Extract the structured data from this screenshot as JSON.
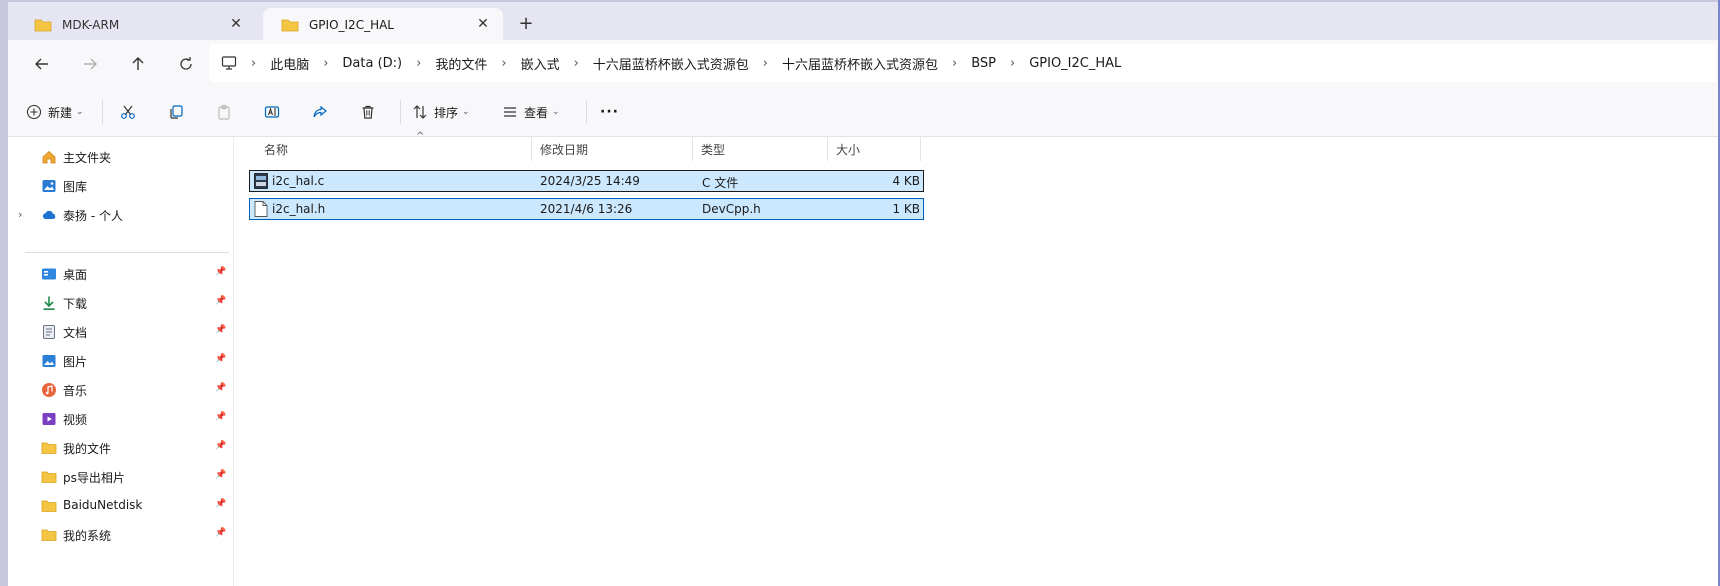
{
  "tabs": [
    {
      "label": "MDK-ARM",
      "active": false
    },
    {
      "label": "GPIO_I2C_HAL",
      "active": true
    }
  ],
  "tab_close_glyph": "✕",
  "tab_add_glyph": "+",
  "breadcrumb": [
    "此电脑",
    "Data (D:)",
    "我的文件",
    "嵌入式",
    "十六届蓝桥杯嵌入式资源包",
    "十六届蓝桥杯嵌入式资源包",
    "BSP",
    "GPIO_I2C_HAL"
  ],
  "breadcrumb_sep": "›",
  "toolbar": {
    "new_label": "新建",
    "sort_label": "排序",
    "view_label": "查看",
    "more_label": "···"
  },
  "sidebar": {
    "top": [
      {
        "label": "主文件夹",
        "icon": "home-icon"
      },
      {
        "label": "图库",
        "icon": "gallery-icon"
      },
      {
        "label": "泰扬 - 个人",
        "icon": "onedrive-icon"
      }
    ],
    "pinned": [
      {
        "label": "桌面",
        "icon": "desktop-icon"
      },
      {
        "label": "下载",
        "icon": "download-icon"
      },
      {
        "label": "文档",
        "icon": "documents-icon"
      },
      {
        "label": "图片",
        "icon": "pictures-icon"
      },
      {
        "label": "音乐",
        "icon": "music-icon"
      },
      {
        "label": "视频",
        "icon": "videos-icon"
      },
      {
        "label": "我的文件",
        "icon": "folder-icon"
      },
      {
        "label": "ps导出相片",
        "icon": "folder-icon"
      },
      {
        "label": "BaiduNetdisk",
        "icon": "folder-icon"
      },
      {
        "label": "我的系统",
        "icon": "folder-icon"
      }
    ]
  },
  "columns": {
    "name": "名称",
    "modified": "修改日期",
    "type": "类型",
    "size": "大小"
  },
  "files": [
    {
      "name": "i2c_hal.c",
      "modified": "2024/3/25 14:49",
      "type": "C 文件",
      "size": "4 KB",
      "icon": "c-source-file-icon"
    },
    {
      "name": "i2c_hal.h",
      "modified": "2021/4/6 13:26",
      "type": "DevCpp.h",
      "size": "1 KB",
      "icon": "header-file-icon"
    }
  ],
  "colors": {
    "selection": "#cce8ff",
    "selection_border": "#0060c0",
    "folder": "#f4c542",
    "accent": "#0067c0"
  }
}
